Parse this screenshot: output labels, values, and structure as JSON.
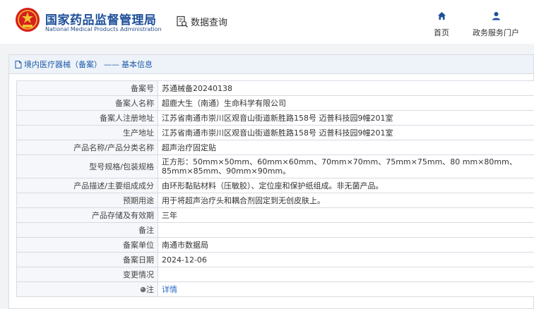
{
  "header": {
    "brand_cn": "国家药品监督管理局",
    "brand_en": "National Medical Products Administration",
    "query_label": "数据查询",
    "nav": [
      {
        "label": "首页",
        "icon": "home-icon"
      },
      {
        "label": "政务服务门户",
        "icon": "user-icon"
      }
    ],
    "accent": "#1d4f9a"
  },
  "breadcrumb": {
    "section": "境内医疗器械（备案）",
    "separator": "——",
    "page": "基本信息"
  },
  "details": [
    {
      "key": "备案号",
      "value": "苏通械备20240138"
    },
    {
      "key": "备案人名称",
      "value": "超鹿大生（南通）生命科学有限公司"
    },
    {
      "key": "备案人注册地址",
      "value": "江苏省南通市崇川区观音山街道新胜路158号 迈普科技园9幢201室"
    },
    {
      "key": "生产地址",
      "value": "江苏省南通市崇川区观音山街道新胜路158号 迈普科技园9幢201室"
    },
    {
      "key": "产品名称/产品分类名称",
      "value": "超声治疗固定贴"
    },
    {
      "key": "型号规格/包装规格",
      "value": "正方形：50mm×50mm、60mm×60mm、70mm×70mm、75mm×75mm、80 mm×80mm、85mm×85mm、90mm×90mm。"
    },
    {
      "key": "产品描述/主要组成成分",
      "value": "由环形黏贴材料（压敏胶）、定位座和保护纸组成。非无菌产品。"
    },
    {
      "key": "预期用途",
      "value": "用于将超声治疗头和耦合剂固定到无创皮肤上。"
    },
    {
      "key": "产品存储及有效期",
      "value": "三年"
    },
    {
      "key": "备注",
      "value": ""
    },
    {
      "key": "备案单位",
      "value": "南通市数据局"
    },
    {
      "key": "备案日期",
      "value": "2024-12-06"
    },
    {
      "key": "变更情况",
      "value": ""
    }
  ],
  "note": {
    "key": "注",
    "link": "详情"
  }
}
